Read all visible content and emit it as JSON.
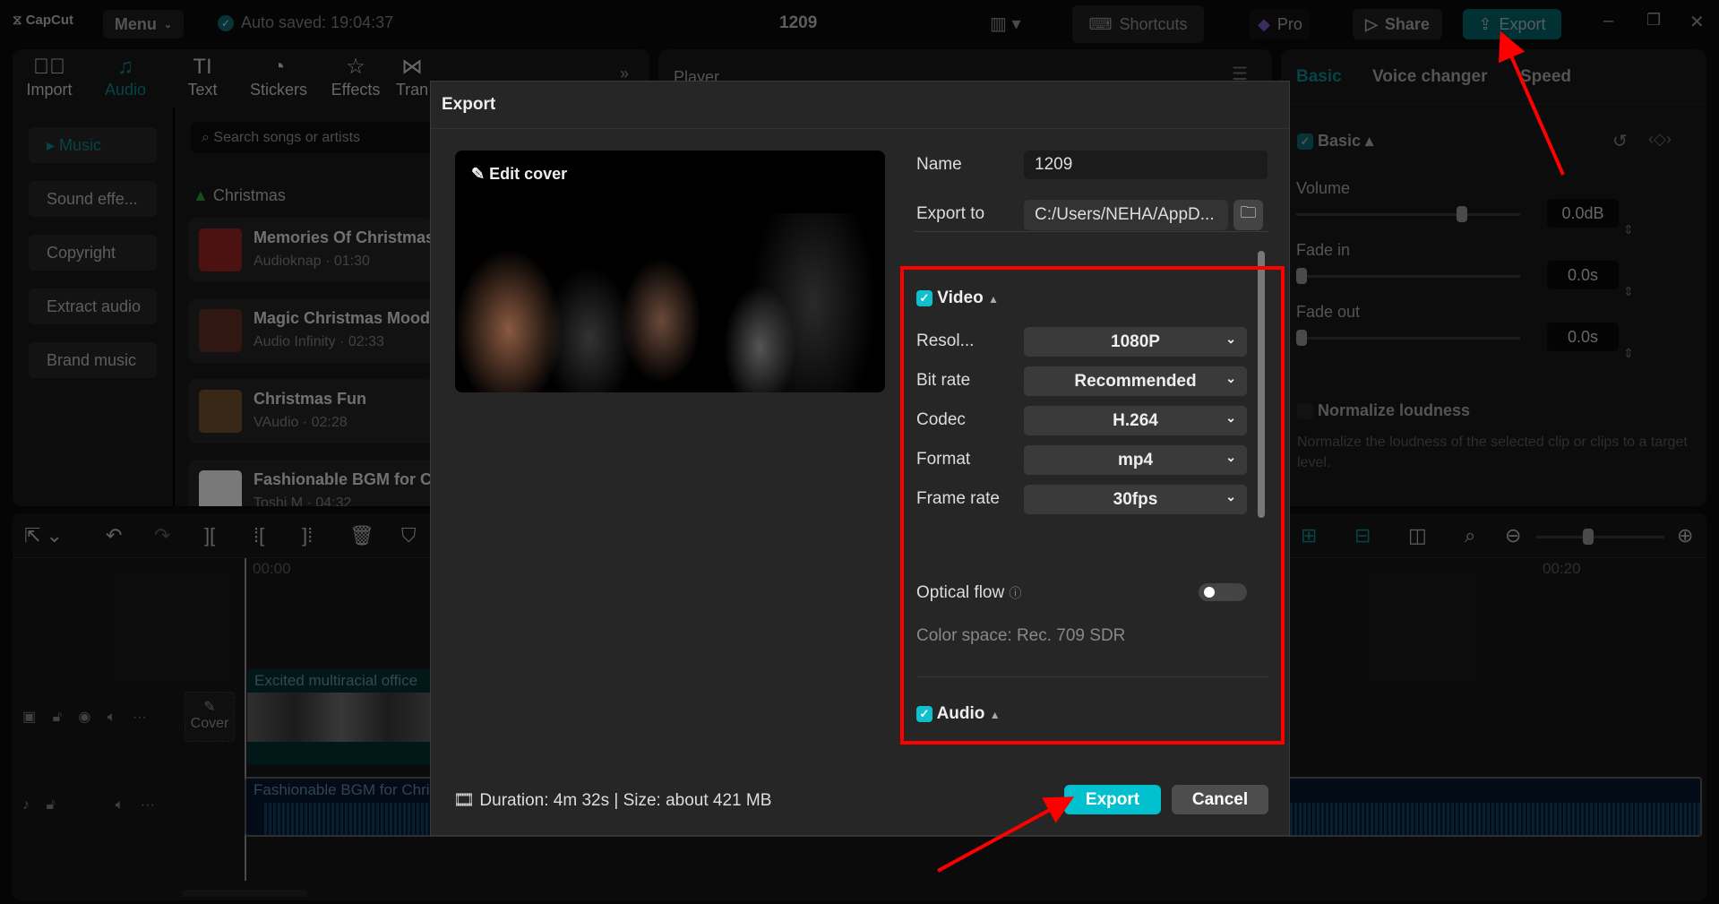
{
  "titlebar": {
    "app_name": "CapCut",
    "menu_label": "Menu",
    "autosave": "Auto saved: 19:04:37",
    "project_title": "1209",
    "shortcuts_label": "Shortcuts",
    "pro_label": "Pro",
    "share_label": "Share",
    "export_label": "Export",
    "accent": "#00c1cd"
  },
  "toolbar": {
    "items": [
      {
        "label": "Import",
        "icon": "import-icon"
      },
      {
        "label": "Audio",
        "icon": "audio-icon",
        "active": true
      },
      {
        "label": "Text",
        "icon": "text-icon"
      },
      {
        "label": "Stickers",
        "icon": "stickers-icon"
      },
      {
        "label": "Effects",
        "icon": "effects-icon"
      },
      {
        "label": "Tran",
        "icon": "transitions-icon"
      }
    ]
  },
  "sidebar": {
    "items": [
      {
        "label": "Music",
        "active": true
      },
      {
        "label": "Sound effe..."
      },
      {
        "label": "Copyright"
      },
      {
        "label": "Extract audio"
      },
      {
        "label": "Brand music"
      }
    ]
  },
  "library": {
    "search_placeholder": "Search songs or artists",
    "category": "Christmas",
    "songs": [
      {
        "title": "Memories Of Christmas",
        "sub": "Audioknap · 01:30"
      },
      {
        "title": "Magic Christmas Mood",
        "sub": "Audio Infinity · 02:33"
      },
      {
        "title": "Christmas Fun",
        "sub": "VAudio · 02:28"
      },
      {
        "title": "Fashionable BGM for Christmas",
        "sub": "Toshi M · 04:32"
      }
    ]
  },
  "player": {
    "title": "Player"
  },
  "right_panel": {
    "tabs": [
      "Basic",
      "Voice changer",
      "Speed"
    ],
    "section": "Basic",
    "volume_label": "Volume",
    "volume_value": "0.0dB",
    "volume_level": 0.75,
    "fade_in_label": "Fade in",
    "fade_in_value": "0.0s",
    "fade_out_label": "Fade out",
    "fade_out_value": "0.0s",
    "normalize_label": "Normalize loudness",
    "normalize_desc": "Normalize the loudness of the selected clip or clips to a target level."
  },
  "timeline": {
    "time_start": "00:00",
    "time_mark": "00:20",
    "video_clip": "Excited multiracial office",
    "audio_clip": "Fashionable BGM for Christmas",
    "cover_label": "Cover",
    "zoom_level": 0.4
  },
  "dialog": {
    "title": "Export",
    "edit_cover": "Edit cover",
    "name_label": "Name",
    "name_value": "1209",
    "export_to_label": "Export to",
    "export_to_value": "C:/Users/NEHA/AppD...",
    "video_label": "Video",
    "settings": [
      {
        "label": "Resol...",
        "value": "1080P"
      },
      {
        "label": "Bit rate",
        "value": "Recommended"
      },
      {
        "label": "Codec",
        "value": "H.264"
      },
      {
        "label": "Format",
        "value": "mp4"
      },
      {
        "label": "Frame rate",
        "value": "30fps"
      }
    ],
    "optical_flow_label": "Optical flow",
    "optical_flow_on": false,
    "color_space": "Color space: Rec. 709 SDR",
    "audio_label": "Audio",
    "footer_info": "Duration: 4m 32s | Size: about 421 MB",
    "export_button": "Export",
    "cancel_button": "Cancel"
  },
  "annotation_color": "#ff0000"
}
